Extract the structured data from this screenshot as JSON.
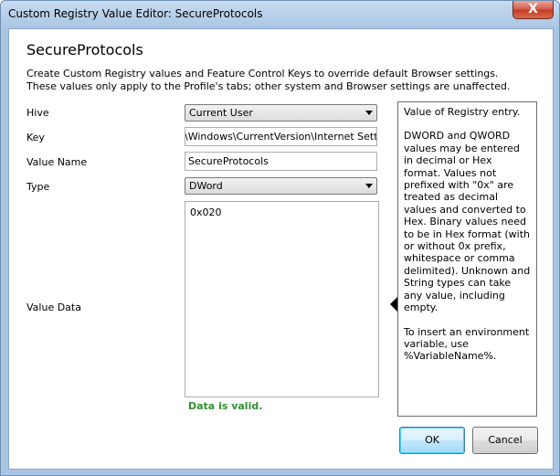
{
  "window": {
    "title": "Custom Registry Value Editor: SecureProtocols",
    "close_label": "X"
  },
  "heading": "SecureProtocols",
  "description": [
    "Create Custom Registry values and Feature Control Keys to override default Browser settings.",
    "These values only apply to the Profile's tabs; other system and Browser settings are unaffected."
  ],
  "fields": {
    "hive": {
      "label": "Hive",
      "value": "Current User"
    },
    "key": {
      "label": "Key",
      "value": "\\Windows\\CurrentVersion\\Internet Settings"
    },
    "value_name": {
      "label": "Value Name",
      "value": "SecureProtocols"
    },
    "type": {
      "label": "Type",
      "value": "DWord"
    },
    "value_data": {
      "label": "Value Data",
      "value": "0x020"
    }
  },
  "validation": "Data is valid.",
  "help": {
    "p1": "Value of Registry entry.",
    "p2": "DWORD and QWORD values may be entered in decimal or Hex format. Values not prefixed with \"0x\" are treated as decimal values and converted to Hex. Binary values need to be in Hex format (with or without 0x prefix, whitespace or comma delimited). Unknown and String types can take any value, including empty.",
    "p3": "To insert an environment variable, use %VariableName%."
  },
  "buttons": {
    "ok": "OK",
    "cancel": "Cancel"
  }
}
